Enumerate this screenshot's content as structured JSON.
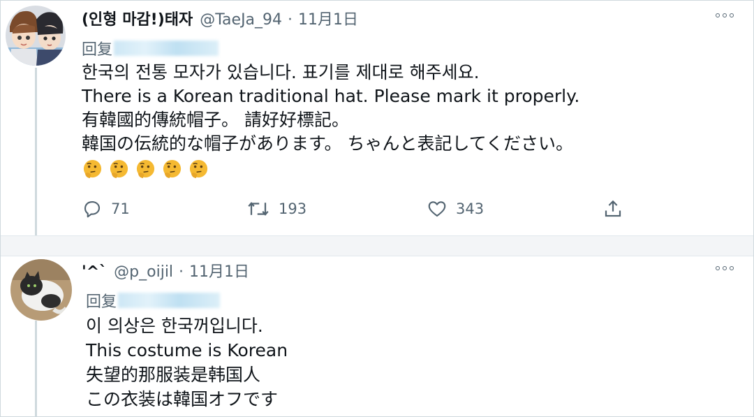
{
  "colors": {
    "text": "#0f1419",
    "secondary": "#536471",
    "divider": "#cfd9de",
    "separator_bg": "#f3f5f7",
    "emoji": "#f5b932"
  },
  "tweets": [
    {
      "display_name": "(인형 마감!)태자",
      "handle": "@TaeJa_94",
      "separator": "·",
      "date": "11月1日",
      "reply_label": "回复",
      "lines": [
        "한국의 전통 모자가 있습니다. 표기를 제대로 해주세요.",
        "There is a Korean traditional hat. Please mark it properly.",
        "有韓國的傳統帽子。 請好好標記。",
        "韓国の伝統的な帽子があります。 ちゃんと表記してください。"
      ],
      "emojis": [
        "thinking-face",
        "thinking-face",
        "thinking-face",
        "thinking-face",
        "thinking-face"
      ],
      "reply_count": "71",
      "retweet_count": "193",
      "like_count": "343"
    },
    {
      "display_name": "'^`",
      "handle": "@p_oijil",
      "separator": "·",
      "date": "11月1日",
      "reply_label": "回复",
      "lines": [
        "이 의상은 한국꺼입니다.",
        "This costume is Korean",
        "失望的那服装是韩国人",
        "この衣装は韓国オフです"
      ]
    }
  ]
}
